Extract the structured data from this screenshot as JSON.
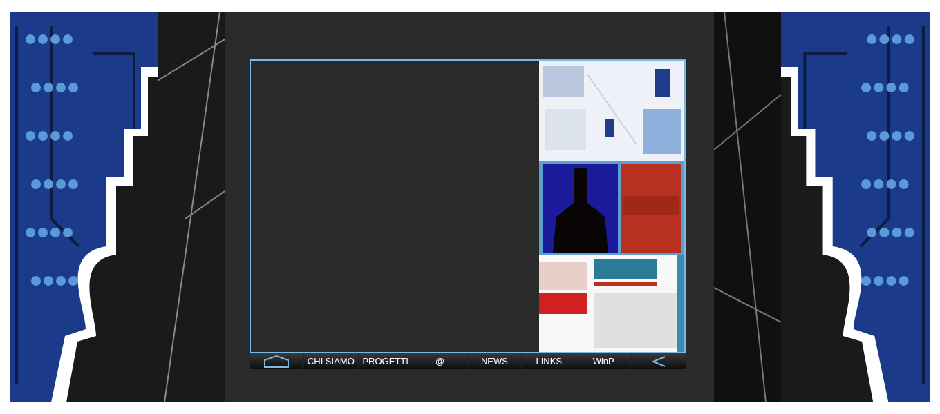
{
  "nav": [
    {
      "label": "CHI SIAMO"
    },
    {
      "label": "PROGETTI"
    },
    {
      "label": "@"
    },
    {
      "label": "NEWS"
    },
    {
      "label": "LINKS"
    },
    {
      "label": "WinP"
    }
  ]
}
